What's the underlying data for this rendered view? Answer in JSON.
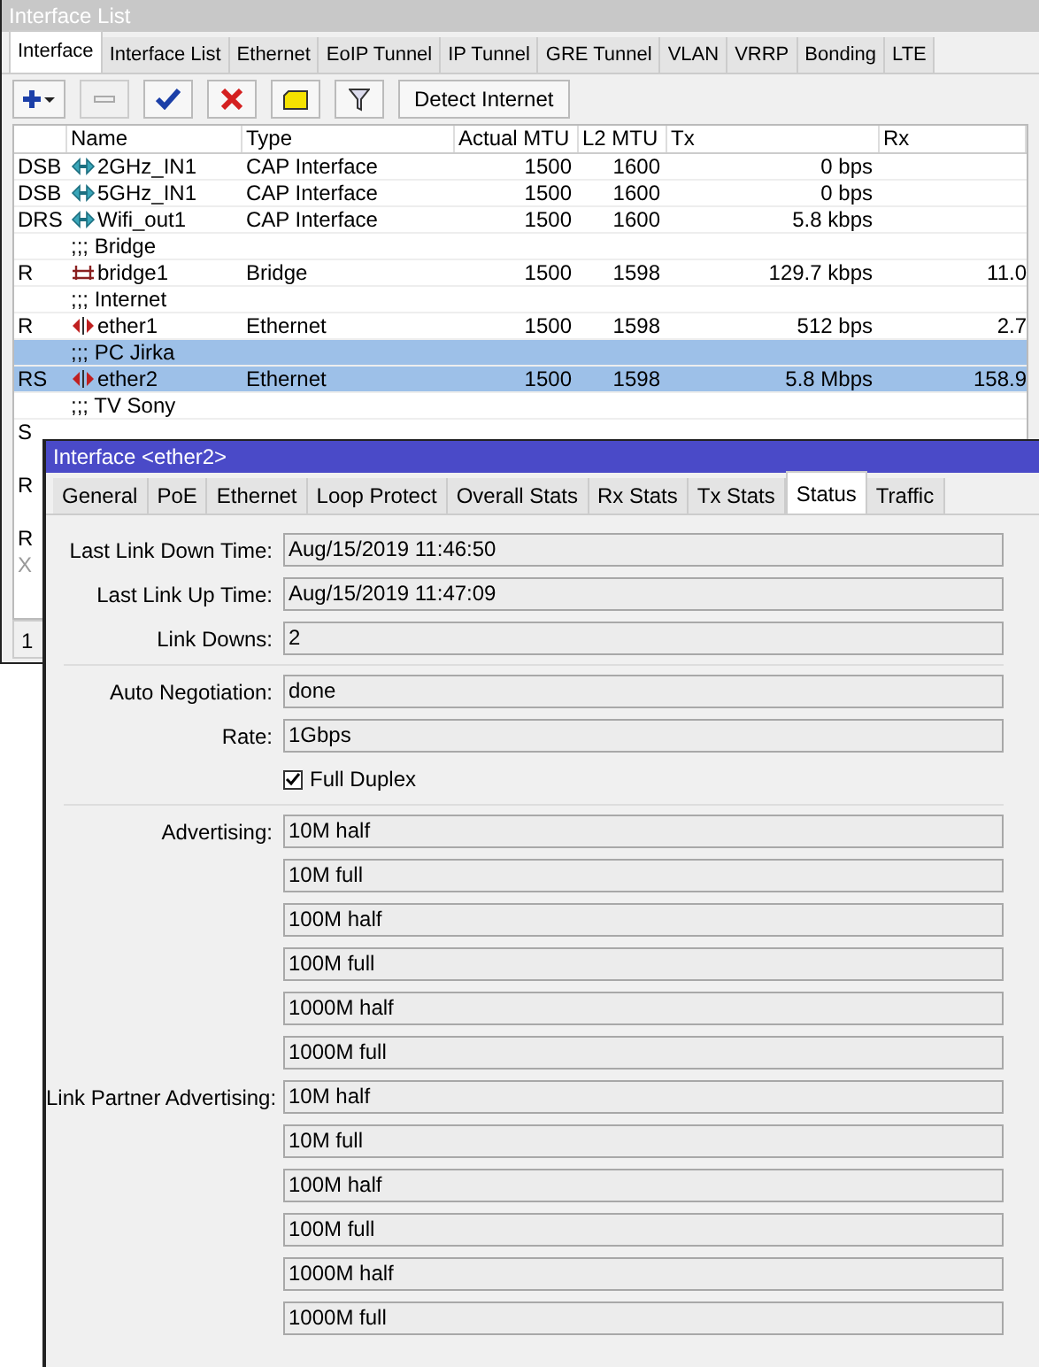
{
  "list_window": {
    "title": "Interface List",
    "tabs": [
      {
        "label": "Interface",
        "selected": true
      },
      {
        "label": "Interface List",
        "selected": false
      },
      {
        "label": "Ethernet",
        "selected": false
      },
      {
        "label": "EoIP Tunnel",
        "selected": false
      },
      {
        "label": "IP Tunnel",
        "selected": false
      },
      {
        "label": "GRE Tunnel",
        "selected": false
      },
      {
        "label": "VLAN",
        "selected": false
      },
      {
        "label": "VRRP",
        "selected": false
      },
      {
        "label": "Bonding",
        "selected": false
      },
      {
        "label": "LTE",
        "selected": false
      }
    ],
    "toolbar": {
      "detect_button": "Detect Internet"
    },
    "table": {
      "columns": [
        "Name",
        "Type",
        "Actual MTU",
        "L2 MTU",
        "Tx",
        "Rx"
      ],
      "rows": [
        {
          "kind": "wireless",
          "flags": "DSB",
          "name": "2GHz_IN1",
          "type": "CAP Interface",
          "actual_mtu": "1500",
          "l2_mtu": "1600",
          "tx": "0 bps",
          "selected": false
        },
        {
          "kind": "wireless",
          "flags": "DSB",
          "name": "5GHz_IN1",
          "type": "CAP Interface",
          "actual_mtu": "1500",
          "l2_mtu": "1600",
          "tx": "0 bps",
          "selected": false
        },
        {
          "kind": "wireless",
          "flags": "DRS",
          "name": "Wifi_out1",
          "type": "CAP Interface",
          "actual_mtu": "1500",
          "l2_mtu": "1600",
          "tx": "5.8 kbps",
          "selected": false
        },
        {
          "kind": "comment",
          "text": ";;; Bridge",
          "selected": false
        },
        {
          "kind": "bridge",
          "flags": "R",
          "name": "bridge1",
          "type": "Bridge",
          "actual_mtu": "1500",
          "l2_mtu": "1598",
          "tx": "129.7 kbps",
          "rx": "11.0",
          "selected": false
        },
        {
          "kind": "comment",
          "text": ";;; Internet",
          "selected": false
        },
        {
          "kind": "ethernet",
          "flags": "R",
          "name": "ether1",
          "type": "Ethernet",
          "actual_mtu": "1500",
          "l2_mtu": "1598",
          "tx": "512 bps",
          "rx": "2.7",
          "selected": false
        },
        {
          "kind": "comment",
          "text": ";;; PC Jirka",
          "selected": true
        },
        {
          "kind": "ethernet",
          "flags": "RS",
          "name": "ether2",
          "type": "Ethernet",
          "actual_mtu": "1500",
          "l2_mtu": "1598",
          "tx": "5.8 Mbps",
          "rx": "158.9",
          "selected": true
        },
        {
          "kind": "comment",
          "text": ";;; TV Sony",
          "selected": false
        }
      ],
      "hidden_rows": [
        {
          "flags": "S",
          "disabled": false
        },
        {
          "flags": "R",
          "disabled": false
        },
        {
          "flags": "R",
          "disabled": false
        },
        {
          "flags": "X",
          "disabled": true
        }
      ]
    },
    "status_bar": "1"
  },
  "dialog": {
    "title": "Interface <ether2>",
    "tabs": [
      {
        "label": "General",
        "selected": false
      },
      {
        "label": "PoE",
        "selected": false
      },
      {
        "label": "Ethernet",
        "selected": false
      },
      {
        "label": "Loop Protect",
        "selected": false
      },
      {
        "label": "Overall Stats",
        "selected": false
      },
      {
        "label": "Rx Stats",
        "selected": false
      },
      {
        "label": "Tx Stats",
        "selected": false
      },
      {
        "label": "Status",
        "selected": true
      },
      {
        "label": "Traffic",
        "selected": false
      }
    ],
    "sections": [
      [
        {
          "kind": "field",
          "label": "Last Link Down Time:",
          "value": "Aug/15/2019 11:46:50"
        },
        {
          "kind": "field",
          "label": "Last Link Up Time:",
          "value": "Aug/15/2019 11:47:09"
        },
        {
          "kind": "field",
          "label": "Link Downs:",
          "value": "2"
        }
      ],
      [
        {
          "kind": "field",
          "label": "Auto Negotiation:",
          "value": "done"
        },
        {
          "kind": "field",
          "label": "Rate:",
          "value": "1Gbps"
        },
        {
          "kind": "checkbox",
          "label": "Full Duplex",
          "checked": true
        }
      ],
      [
        {
          "kind": "field",
          "label": "Advertising:",
          "value": "10M half"
        },
        {
          "kind": "field",
          "value": "10M full"
        },
        {
          "kind": "field",
          "value": "100M half"
        },
        {
          "kind": "field",
          "value": "100M full"
        },
        {
          "kind": "field",
          "value": "1000M half"
        },
        {
          "kind": "field",
          "value": "1000M full"
        },
        {
          "kind": "field",
          "label": "Link Partner Advertising:",
          "value": "10M half"
        },
        {
          "kind": "field",
          "value": "10M full"
        },
        {
          "kind": "field",
          "value": "100M half"
        },
        {
          "kind": "field",
          "value": "100M full"
        },
        {
          "kind": "field",
          "value": "1000M half"
        },
        {
          "kind": "field",
          "value": "1000M full"
        }
      ]
    ]
  }
}
